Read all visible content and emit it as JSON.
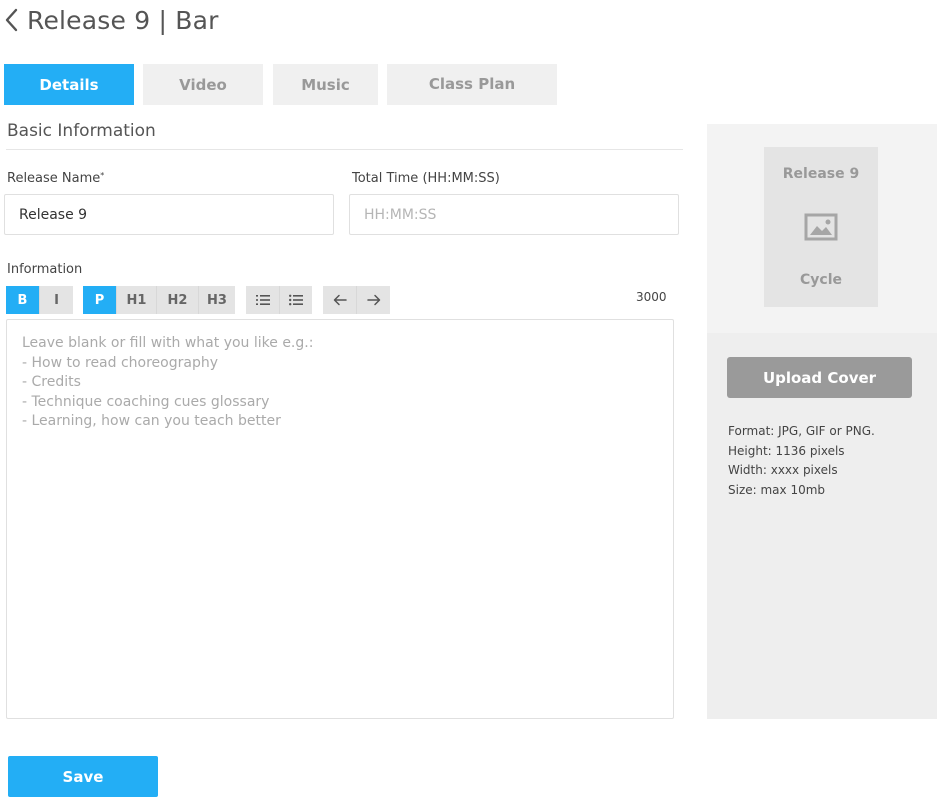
{
  "header": {
    "title": "Release 9 | Bar",
    "back_icon": "chevron-left-icon"
  },
  "tabs": [
    {
      "label": "Details",
      "active": true
    },
    {
      "label": "Video",
      "active": false
    },
    {
      "label": "Music",
      "active": false
    },
    {
      "label": "Class Plan",
      "active": false
    }
  ],
  "basic_info": {
    "section_title": "Basic Information",
    "release_name": {
      "label": "Release Name",
      "required_mark": "*",
      "value": "Release 9"
    },
    "total_time": {
      "label": "Total Time (HH:MM:SS)",
      "value": "",
      "placeholder": "HH:MM:SS"
    }
  },
  "information": {
    "label": "Information",
    "toolbar": {
      "bold": "B",
      "italic": "I",
      "paragraph": "P",
      "h1": "H1",
      "h2": "H2",
      "h3": "H3",
      "ordered_list_icon": "ordered-list-icon",
      "bullet_list_icon": "bullet-list-icon",
      "undo_icon": "arrow-left-icon",
      "redo_icon": "arrow-right-icon"
    },
    "active_buttons": [
      "bold",
      "paragraph"
    ],
    "char_count": "3000",
    "value": "",
    "placeholder": "Leave blank or fill with what you like e.g.:\n- How to read choreography\n- Credits\n- Technique coaching cues glossary\n- Learning, how can you teach better"
  },
  "cover": {
    "preview_title": "Release 9",
    "preview_icon": "image-icon",
    "preview_subtitle": "Cycle",
    "upload_label": "Upload Cover",
    "info": {
      "format": "Format: JPG, GIF or PNG.",
      "height": "Height: 1136 pixels",
      "width": "Width: xxxx pixels",
      "size": "Size: max 10mb"
    }
  },
  "actions": {
    "save_label": "Save"
  },
  "colors": {
    "accent": "#23aef5",
    "tab_inactive": "#f0f0f0",
    "upload_button": "#9a9a9a",
    "panel_bg": "#eeeeee"
  }
}
